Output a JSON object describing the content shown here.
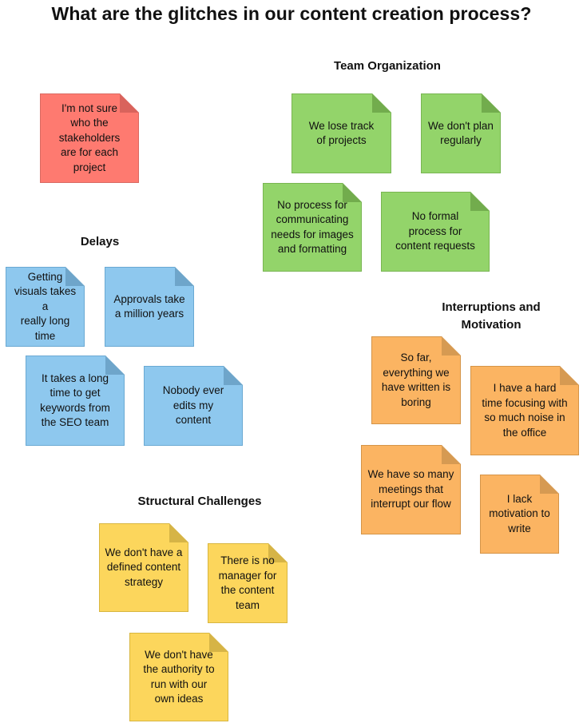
{
  "title": "What are the glitches in our content creation process?",
  "colors": {
    "red": "#fe7a70",
    "green": "#93d46a",
    "blue": "#8ec8ee",
    "orange": "#fbb462",
    "yellow": "#fcd65c"
  },
  "ungrouped": {
    "notes": [
      {
        "text": "I'm not sure\nwho the\nstakeholders\nare for each\nproject",
        "color": "red"
      }
    ]
  },
  "groups": {
    "team_organization": {
      "heading": "Team Organization",
      "notes": [
        {
          "text": "We lose track\nof projects",
          "color": "green"
        },
        {
          "text": "We don't plan\nregularly",
          "color": "green"
        },
        {
          "text": "No process for\ncommunicating\nneeds for images\nand formatting",
          "color": "green"
        },
        {
          "text": "No formal\nprocess for\ncontent requests",
          "color": "green"
        }
      ]
    },
    "delays": {
      "heading": "Delays",
      "notes": [
        {
          "text": "Getting\nvisuals takes a\nreally long\ntime",
          "color": "blue"
        },
        {
          "text": "Approvals take\na million years",
          "color": "blue"
        },
        {
          "text": "It takes a long\ntime to get\nkeywords from\nthe SEO team",
          "color": "blue"
        },
        {
          "text": "Nobody ever\nedits my\ncontent",
          "color": "blue"
        }
      ]
    },
    "interruptions": {
      "heading": "Interruptions and\nMotivation",
      "notes": [
        {
          "text": "So far,\neverything we\nhave written is\nboring",
          "color": "orange"
        },
        {
          "text": "I have a hard\ntime focusing with\nso much noise in\nthe office",
          "color": "orange"
        },
        {
          "text": "We have so many\nmeetings that\ninterrupt our flow",
          "color": "orange"
        },
        {
          "text": "I lack\nmotivation to\nwrite",
          "color": "orange"
        }
      ]
    },
    "structural": {
      "heading": "Structural Challenges",
      "notes": [
        {
          "text": "We don't have a\ndefined content\nstrategy",
          "color": "yellow"
        },
        {
          "text": "There is no\nmanager for\nthe content\nteam",
          "color": "yellow"
        },
        {
          "text": "We don't have\nthe authority to\nrun with our\nown ideas",
          "color": "yellow"
        }
      ]
    }
  }
}
